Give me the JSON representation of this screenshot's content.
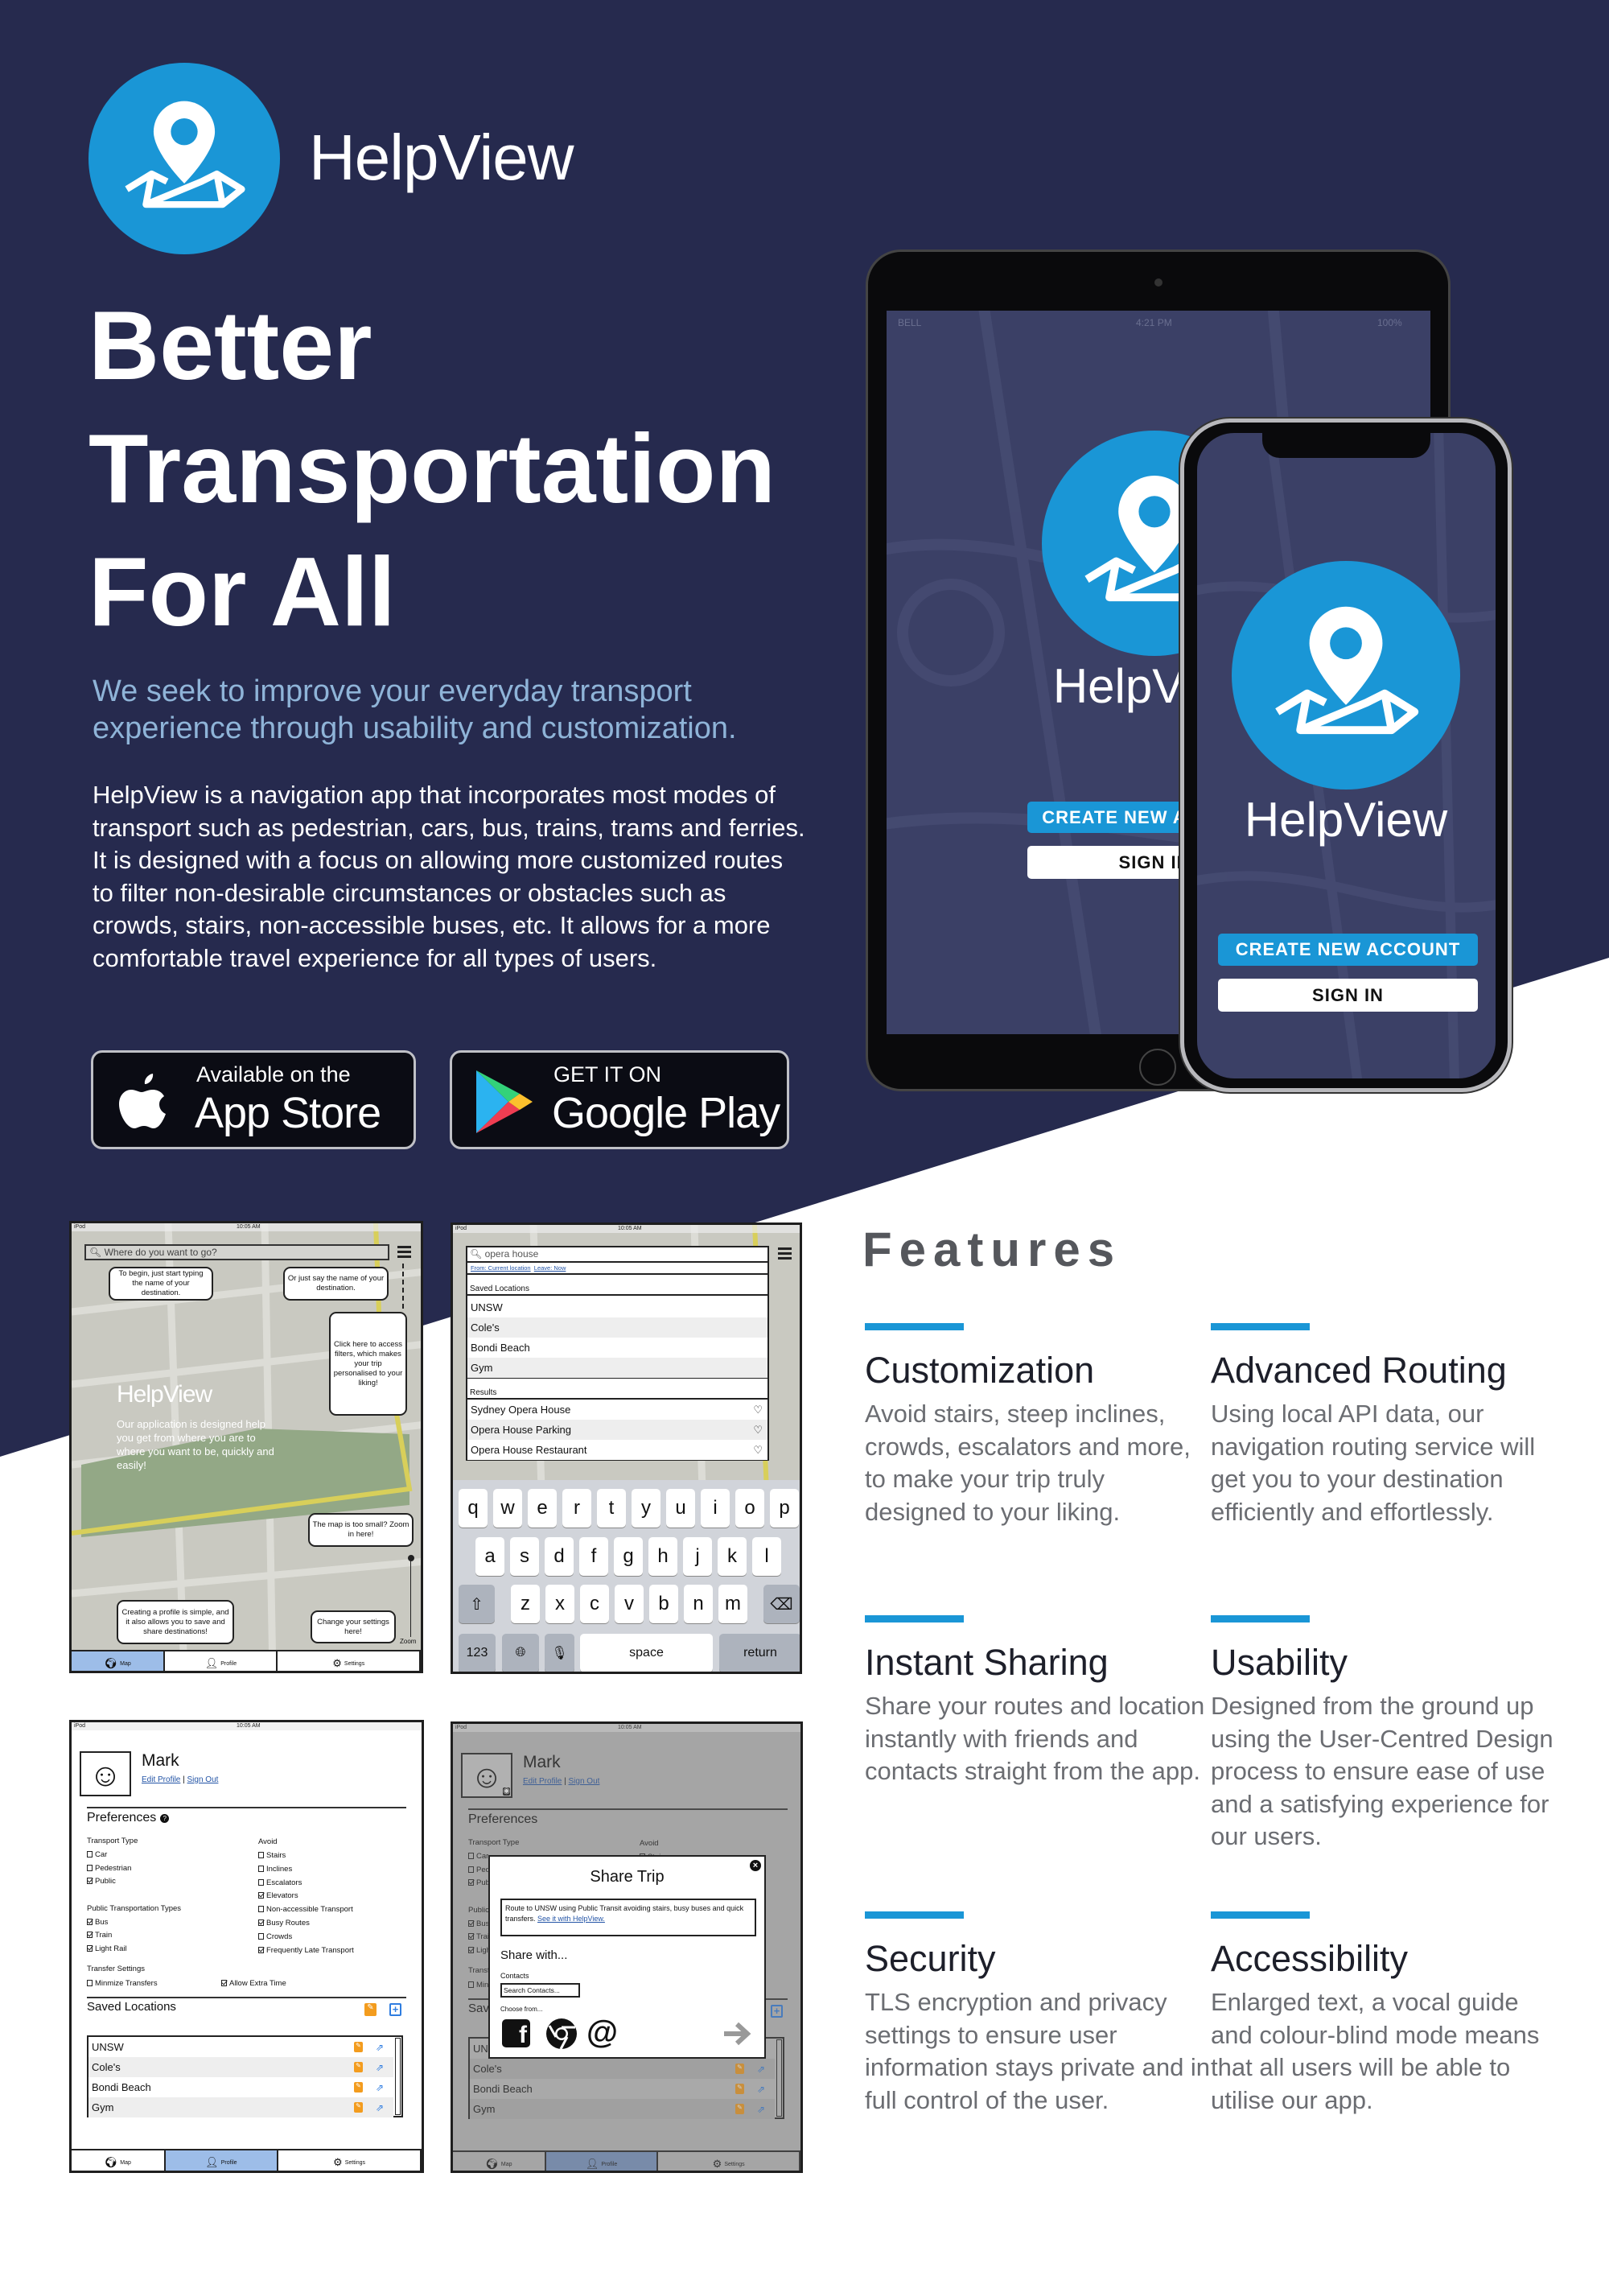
{
  "brand": {
    "name": "HelpView",
    "accent": "#1a96d6",
    "background": "#262a4e"
  },
  "hero": {
    "headline": [
      "Better",
      "Transportation",
      "For All"
    ],
    "subtitle": "We seek to improve your everyday transport experience through usability and customization.",
    "body": "HelpView is a navigation app that incorporates most modes of transport such as pedestrian, cars, bus, trains, trams and ferries. It is designed with a focus on allowing more customized routes to filter non-desirable circumstances or obstacles such as crowds, stairs, non-accessible buses, etc. It allows for a more comfortable travel experience for all types of users."
  },
  "badges": {
    "appstore": {
      "top": "Available on the",
      "main": "App Store",
      "icon": "apple-icon"
    },
    "googleplay": {
      "top": "GET IT ON",
      "main": "Google Play",
      "icon": "google-play-icon"
    }
  },
  "devices": {
    "tablet": {
      "carrier": "BELL",
      "time": "4:21 PM",
      "battery": "100%",
      "app_name": "HelpView",
      "create_label": "CREATE NEW ACCOUNT",
      "signin_label": "SIGN IN"
    },
    "phone": {
      "app_name": "HelpView",
      "create_label": "CREATE NEW ACCOUNT",
      "signin_label": "SIGN IN"
    }
  },
  "screens": {
    "status": {
      "device": "iPod",
      "time": "10:05 AM"
    },
    "tabs": [
      "Map",
      "Profile",
      "Settings"
    ],
    "map": {
      "search_placeholder": "Where do you want to go?",
      "tip_type": "To begin, just start typing the name of your destination.",
      "tip_say": "Or just say the name of your destination.",
      "tip_filters": "Click here to access filters, which makes your trip personalised to your liking!",
      "brand": "HelpView",
      "description": "Our application is designed help you get from where you are to where you want to be, quickly and easily!",
      "tip_zoom": "The map is too small? Zoom in here!",
      "tip_profile": "Creating a profile is simple, and it also allows you to save and share destinations!",
      "tip_settings": "Change your settings here!",
      "zoom_label": "Zoom"
    },
    "search": {
      "query": "opera house",
      "from": "From: Current location",
      "leave": "Leave: Now",
      "saved_header": "Saved Locations",
      "saved": [
        "UNSW",
        "Cole's",
        "Bondi Beach",
        "Gym"
      ],
      "results_header": "Results",
      "results": [
        "Sydney Opera House",
        "Opera House Parking",
        "Opera House Restaurant"
      ],
      "keyboard": {
        "rows": [
          [
            "q",
            "w",
            "e",
            "r",
            "t",
            "y",
            "u",
            "i",
            "o",
            "p"
          ],
          [
            "a",
            "s",
            "d",
            "f",
            "g",
            "h",
            "j",
            "k",
            "l"
          ],
          [
            "z",
            "x",
            "c",
            "v",
            "b",
            "n",
            "m"
          ]
        ],
        "numbers": "123",
        "space": "space",
        "return": "return"
      }
    },
    "profile": {
      "name": "Mark",
      "edit": "Edit Profile",
      "signout": "Sign Out",
      "preferences_title": "Preferences",
      "left": [
        {
          "label": "Transport Type",
          "heading": true
        },
        {
          "label": "Car",
          "checked": false
        },
        {
          "label": "Pedestrian",
          "checked": false
        },
        {
          "label": "Public",
          "checked": true
        },
        {
          "label": "Public Transportation Types",
          "heading": true
        },
        {
          "label": "Bus",
          "checked": true
        },
        {
          "label": "Train",
          "checked": true
        },
        {
          "label": "Light Rail",
          "checked": true
        },
        {
          "label": "Transfer Settings",
          "heading": true
        },
        {
          "label": "Minmize Transfers",
          "checked": false
        }
      ],
      "right": [
        {
          "label": "Avoid",
          "heading": true
        },
        {
          "label": "Stairs",
          "checked": false
        },
        {
          "label": "Inclines",
          "checked": false
        },
        {
          "label": "Escalators",
          "checked": false
        },
        {
          "label": "Elevators",
          "checked": true
        },
        {
          "label": "Non-accessible Transport",
          "checked": false
        },
        {
          "label": "Busy Routes",
          "checked": true
        },
        {
          "label": "Crowds",
          "checked": false
        },
        {
          "label": "Frequently Late Transport",
          "checked": true
        }
      ],
      "extra": {
        "label": "Allow Extra Time",
        "checked": true
      },
      "saved_title": "Saved Locations",
      "saved": [
        "UNSW",
        "Cole's",
        "Bondi Beach",
        "Gym"
      ]
    },
    "share": {
      "title": "Share Trip",
      "message": "Route to UNSW using Public Transit avoiding stairs, busy buses and quick transfers.",
      "message_link": "See it with HelpView.",
      "share_with": "Share with...",
      "contacts_label": "Contacts",
      "contacts_placeholder": "Search Contacts...",
      "choose_from": "Choose from...",
      "options": [
        "facebook-icon",
        "chrome-icon",
        "email-at-icon"
      ]
    }
  },
  "features": {
    "title": "Features",
    "items": [
      {
        "heading": "Customization",
        "text": "Avoid stairs, steep inclines, crowds, escalators and more, to make your trip truly designed to your liking."
      },
      {
        "heading": "Advanced Routing",
        "text": "Using local API data, our navigation routing service will get you to your destination efficiently and effortlessly."
      },
      {
        "heading": "Instant Sharing",
        "text": "Share your routes and location instantly with friends and contacts straight from the app."
      },
      {
        "heading": "Usability",
        "text": "Designed from the ground up using the User-Centred Design process to ensure ease of use and a satisfying experience for our users."
      },
      {
        "heading": "Security",
        "text": "TLS encryption and privacy settings to ensure user information stays private and in full control of the user."
      },
      {
        "heading": "Accessibility",
        "text": "Enlarged text, a vocal guide and colour-blind mode means that all users will be able to utilise our app."
      }
    ]
  }
}
